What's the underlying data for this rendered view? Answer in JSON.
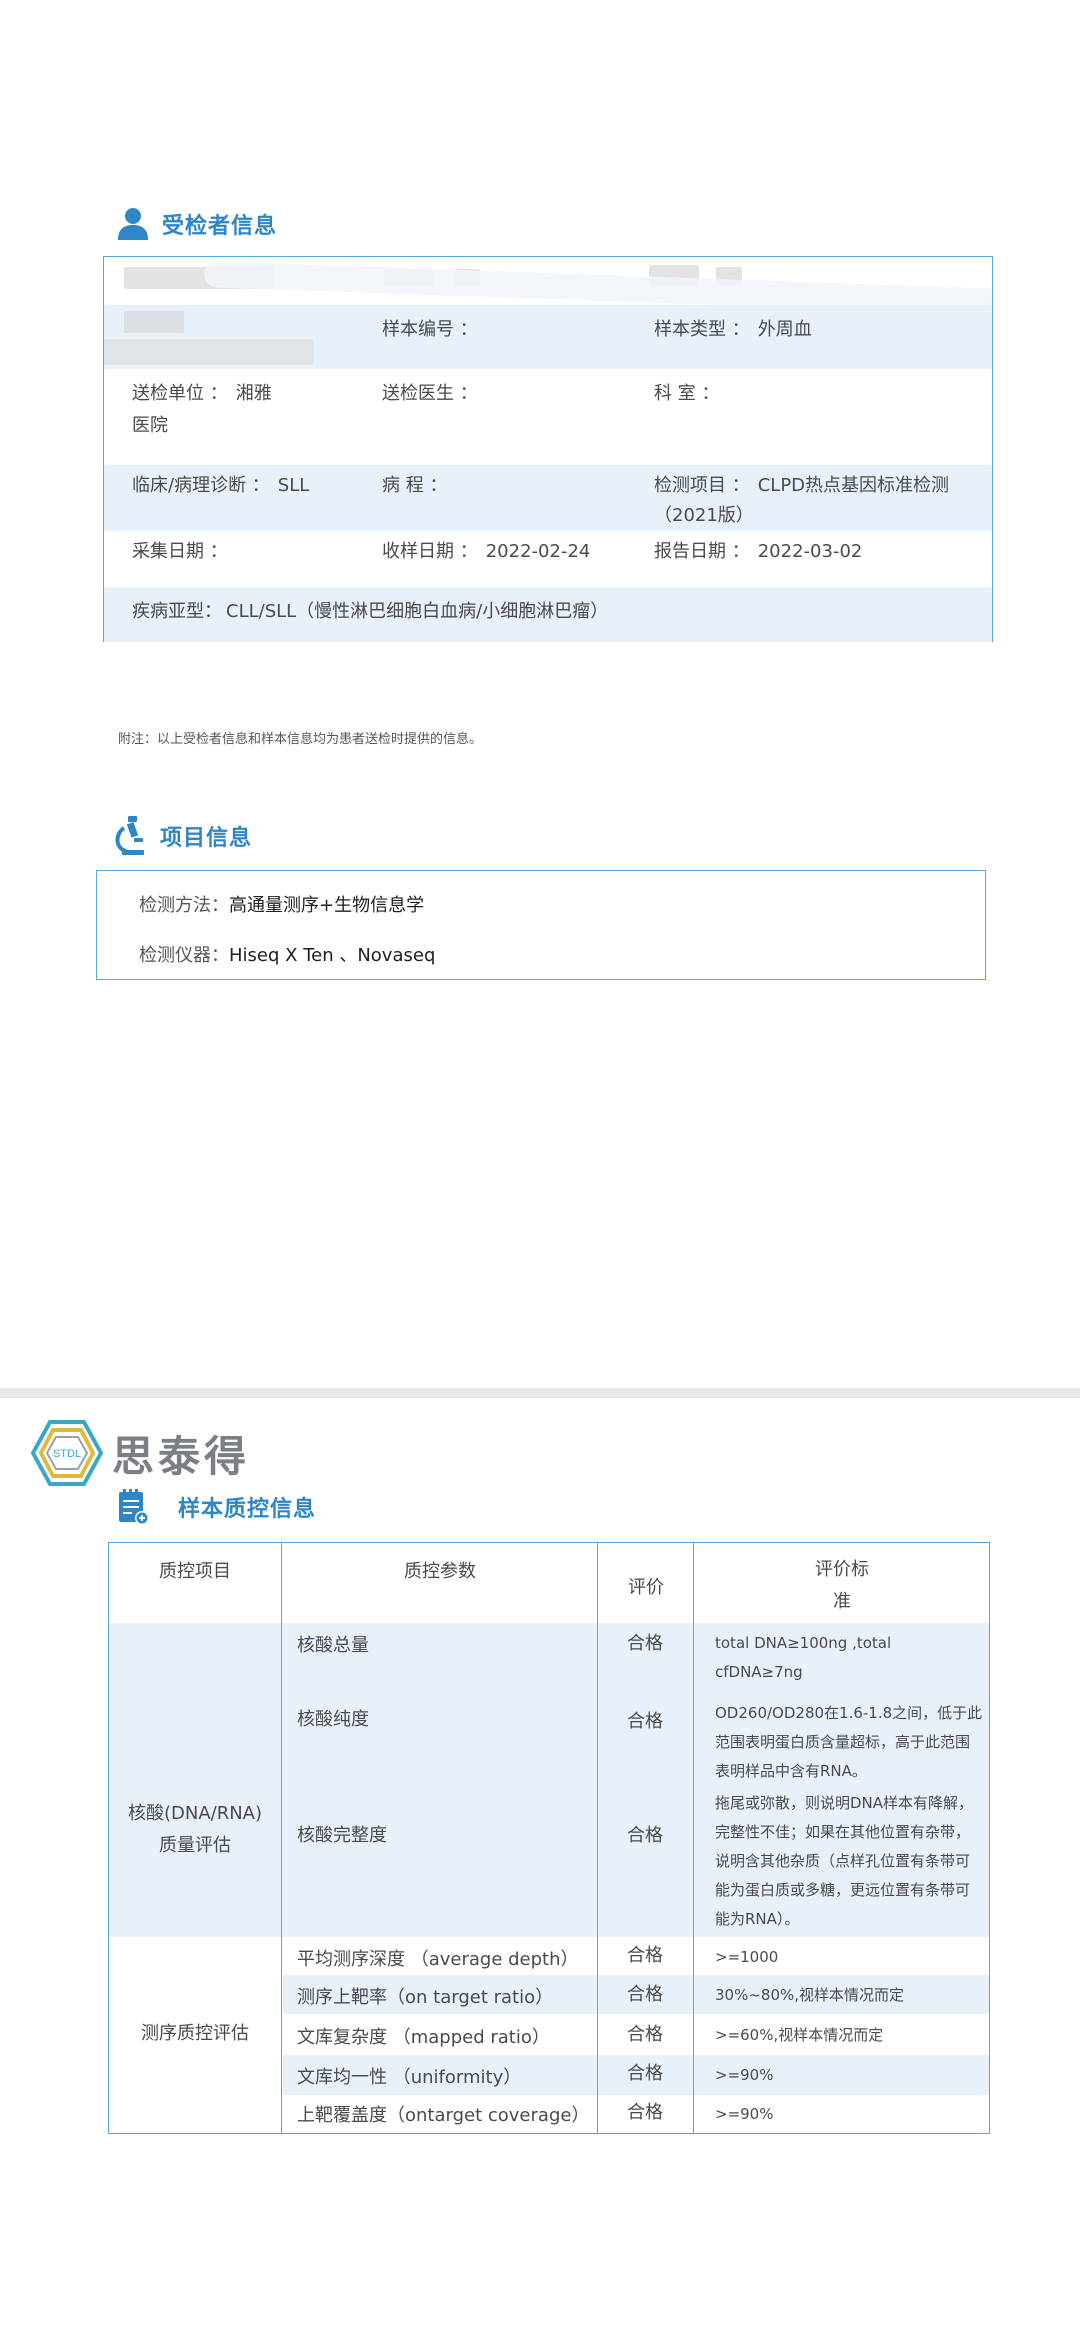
{
  "patient_section": {
    "title": "受检者信息",
    "rows": [
      {
        "sample_no_label": "样本编号 ：",
        "sample_type_label": "样本类型 ：",
        "sample_type_value": "外周血"
      },
      {
        "unit_label": "送检单位 ：",
        "unit_value_1": "湘雅",
        "unit_value_2": "医院",
        "doctor_label": "送检医生 ：",
        "dept_label": "科 室 ："
      },
      {
        "diag_label": "临床/病理诊断 ：",
        "diag_value": "SLL",
        "course_label": "病 程 ：",
        "item_label": "检测项目 ：",
        "item_value_1": "CLPD热点基因标准检测",
        "item_value_2": "（2021版）"
      },
      {
        "collect_label": "采集日期 ：",
        "receive_label": "收样日期 ：",
        "receive_value": "2022-02-24",
        "report_label": "报告日期 ：",
        "report_value": "2022-03-02"
      },
      {
        "subtype_label": "疾病亚型：",
        "subtype_value": "CLL/SLL（慢性淋巴细胞白血病/小细胞淋巴瘤）"
      }
    ]
  },
  "note": "附注：以上受检者信息和样本信息均为患者送检时提供的信息。",
  "project_section": {
    "title": "项目信息",
    "method_label": "检测方法：",
    "method_value": "高通量测序+生物信息学",
    "instrument_label": "检测仪器：",
    "instrument_value": "Hiseq X Ten 、Novaseq"
  },
  "logo": {
    "badge_text": "STDL",
    "name": "思泰得"
  },
  "qc_section": {
    "title": "样本质控信息",
    "headers": {
      "item": "质控项目",
      "param": "质控参数",
      "eval": "评价",
      "standard_1": "评价标",
      "standard_2": "准"
    },
    "group1": {
      "name_1": "核酸(DNA/RNA)",
      "name_2": "质量评估"
    },
    "group2": {
      "name": "测序质控评估"
    },
    "rows": [
      {
        "param": "核酸总量",
        "eval": "合格",
        "std_1": "total DNA≥100ng ,total",
        "std_2": "cfDNA≥7ng"
      },
      {
        "param": "核酸纯度",
        "eval": "合格",
        "std_1": "OD260/OD280在1.6-1.8之间，低于此",
        "std_2": "范围表明蛋白质含量超标，高于此范围",
        "std_3": "表明样品中含有RNA。"
      },
      {
        "param": "核酸完整度",
        "eval": "合格",
        "std_1": "拖尾或弥散，则说明DNA样本有降解，",
        "std_2": "完整性不佳；如果在其他位置有杂带，",
        "std_3": "说明含其他杂质（点样孔位置有条带可",
        "std_4": "能为蛋白质或多糖，更远位置有条带可",
        "std_5": "能为RNA）。"
      },
      {
        "param": "平均测序深度 （average depth）",
        "eval": "合格",
        "std_1": ">=1000"
      },
      {
        "param": "测序上靶率（on target ratio）",
        "eval": "合格",
        "std_1": "30%~80%,视样本情况而定"
      },
      {
        "param": "文库复杂度 （mapped ratio）",
        "eval": "合格",
        "std_1": ">=60%,视样本情况而定"
      },
      {
        "param": "文库均一性 （uniformity）",
        "eval": "合格",
        "std_1": ">=90%"
      },
      {
        "param": "上靶覆盖度（ontarget coverage）",
        "eval": "合格",
        "std_1": ">=90%"
      }
    ]
  },
  "colors": {
    "accent": "#2f86c6",
    "border": "#5aa6d6",
    "row_fill": "#e8f1fa",
    "logo_gray": "#7a7f85"
  }
}
